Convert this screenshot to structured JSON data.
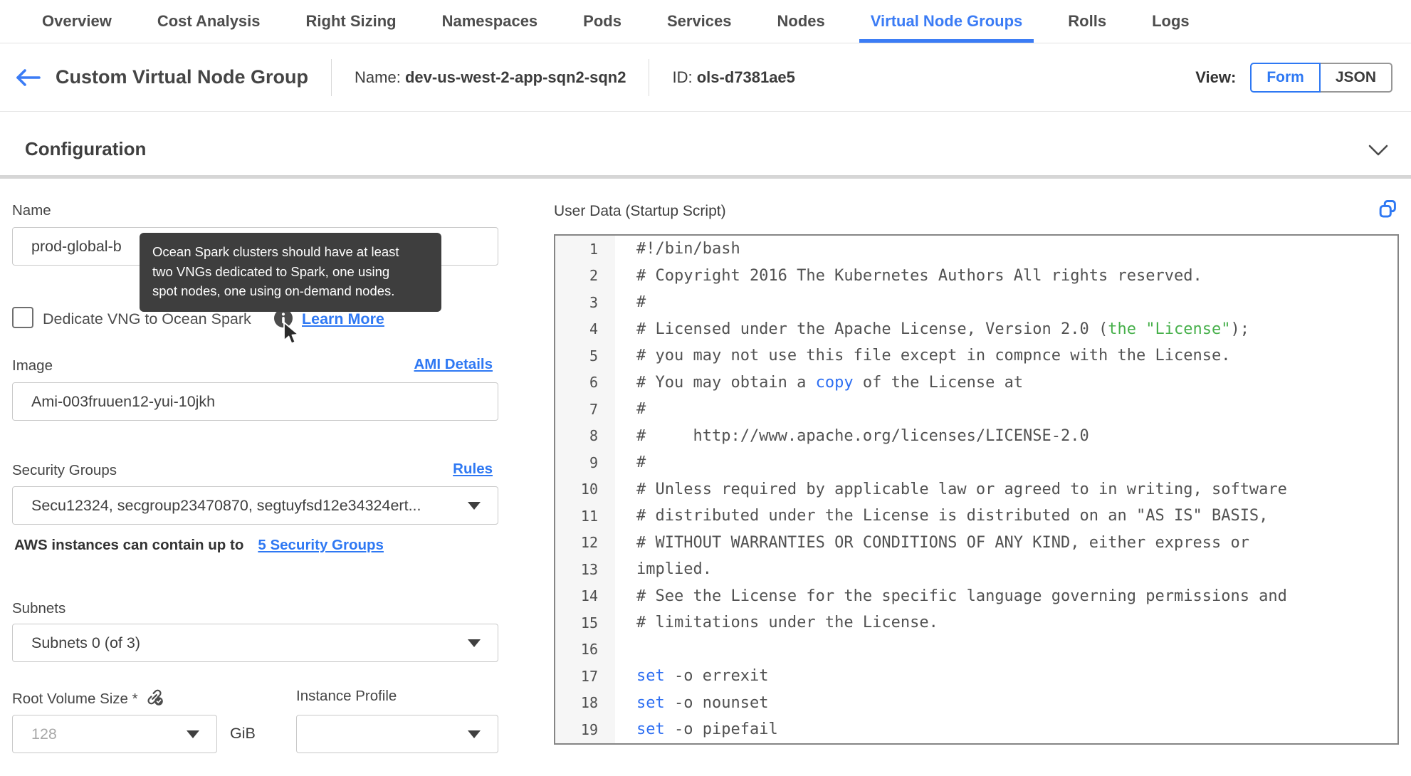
{
  "tab_bar": {
    "tabs": [
      {
        "label": "Overview",
        "active": false
      },
      {
        "label": "Cost Analysis",
        "active": false
      },
      {
        "label": "Right Sizing",
        "active": false
      },
      {
        "label": "Namespaces",
        "active": false
      },
      {
        "label": "Pods",
        "active": false
      },
      {
        "label": "Services",
        "active": false
      },
      {
        "label": "Nodes",
        "active": false
      },
      {
        "label": "Virtual Node Groups",
        "active": true
      },
      {
        "label": "Rolls",
        "active": false
      },
      {
        "label": "Logs",
        "active": false
      }
    ]
  },
  "header": {
    "title": "Custom Virtual Node Group",
    "name_label": "Name:",
    "name_value": "dev-us-west-2-app-sqn2-sqn2",
    "id_label": "ID:",
    "id_value": "ols-d7381ae5",
    "view_label": "View:",
    "view_options": [
      {
        "label": "Form",
        "active": true
      },
      {
        "label": "JSON",
        "active": false
      }
    ]
  },
  "section": {
    "title": "Configuration"
  },
  "form": {
    "name": {
      "label": "Name",
      "value": "prod-global-b"
    },
    "dedicate": {
      "label": "Dedicate VNG to Ocean Spark",
      "checked": false,
      "learn_more": "Learn More"
    },
    "image": {
      "label": "Image",
      "link": "AMI Details",
      "value": "Ami-003fruuen12-yui-10jkh"
    },
    "security_groups": {
      "label": "Security Groups",
      "link": "Rules",
      "value": "Secu12324, secgroup23470870, segtuyfsd12e34324ert...",
      "note_text": "AWS instances can contain up to",
      "note_link": "5 Security Groups"
    },
    "subnets": {
      "label": "Subnets",
      "value": "Subnets 0 (of 3)"
    },
    "root_volume": {
      "label": "Root Volume Size *",
      "placeholder": "128",
      "unit": "GiB"
    },
    "instance_profile": {
      "label": "Instance Profile",
      "value": ""
    }
  },
  "tooltip": {
    "text": "Ocean Spark clusters should have at least two VNGs dedicated to Spark, one using spot nodes, one using on-demand nodes.",
    "lines": [
      "Ocean Spark clusters should have at least",
      "two VNGs dedicated to Spark, one using",
      "spot nodes, one using on-demand nodes."
    ]
  },
  "editor": {
    "label": "User Data (Startup Script)",
    "lines": [
      {
        "n": "1",
        "segments": [
          {
            "color": "plain",
            "text": "#!/bin/bash"
          }
        ]
      },
      {
        "n": "2",
        "segments": [
          {
            "color": "plain",
            "text": "# Copyright 2016 The Kubernetes Authors All rights reserved."
          }
        ]
      },
      {
        "n": "3",
        "segments": [
          {
            "color": "plain",
            "text": "#"
          }
        ]
      },
      {
        "n": "4",
        "segments": [
          {
            "color": "plain",
            "text": "# Licensed under the Apache License, Version 2.0 ("
          },
          {
            "color": "green",
            "text": "the \"License\""
          },
          {
            "color": "plain",
            "text": ");"
          }
        ]
      },
      {
        "n": "5",
        "segments": [
          {
            "color": "plain",
            "text": "# you may not use this file except in compnce with the License."
          }
        ]
      },
      {
        "n": "6",
        "segments": [
          {
            "color": "plain",
            "text": "# You may obtain a "
          },
          {
            "color": "blue",
            "text": "copy"
          },
          {
            "color": "plain",
            "text": " of the License at"
          }
        ]
      },
      {
        "n": "7",
        "segments": [
          {
            "color": "plain",
            "text": "#"
          }
        ]
      },
      {
        "n": "8",
        "segments": [
          {
            "color": "plain",
            "text": "#     http://www.apache.org/licenses/LICENSE-2.0"
          }
        ]
      },
      {
        "n": "9",
        "segments": [
          {
            "color": "plain",
            "text": "#"
          }
        ]
      },
      {
        "n": "10",
        "segments": [
          {
            "color": "plain",
            "text": "# Unless required by applicable law or agreed to in writing, software"
          }
        ]
      },
      {
        "n": "11",
        "segments": [
          {
            "color": "plain",
            "text": "# distributed under the License is distributed on an \"AS IS\" BASIS,"
          }
        ]
      },
      {
        "n": "12",
        "segments": [
          {
            "color": "plain",
            "text": "# WITHOUT WARRANTIES OR CONDITIONS OF ANY KIND, either express or"
          }
        ]
      },
      {
        "n": "13",
        "segments": [
          {
            "color": "plain",
            "text": "implied."
          }
        ]
      },
      {
        "n": "14",
        "segments": [
          {
            "color": "plain",
            "text": "# See the License for the specific language governing permissions and"
          }
        ]
      },
      {
        "n": "15",
        "segments": [
          {
            "color": "plain",
            "text": "# limitations under the License."
          }
        ]
      },
      {
        "n": "16",
        "segments": []
      },
      {
        "n": "17",
        "segments": [
          {
            "color": "blue",
            "text": "set"
          },
          {
            "color": "plain",
            "text": " -o errexit"
          }
        ]
      },
      {
        "n": "18",
        "segments": [
          {
            "color": "blue",
            "text": "set"
          },
          {
            "color": "plain",
            "text": " -o nounset"
          }
        ]
      },
      {
        "n": "19",
        "segments": [
          {
            "color": "blue",
            "text": "set"
          },
          {
            "color": "plain",
            "text": " -o pipefail"
          }
        ]
      }
    ]
  },
  "icons": {
    "back": "arrow-left-icon",
    "collapse": "chevron-down-icon",
    "info": "info-icon",
    "root_volume_link": "link-check-icon",
    "copy": "copy-icon",
    "cursor": "mouse-cursor-icon",
    "dropdown": "caret-down-icon"
  },
  "colors": {
    "accent_blue": "#3b7cf5",
    "link_blue": "#2e78f3",
    "code_green": "#47b04b",
    "code_blue": "#2e6ff2",
    "tooltip_bg": "#3e3e3e",
    "divider_gray": "#d6d6d6"
  }
}
